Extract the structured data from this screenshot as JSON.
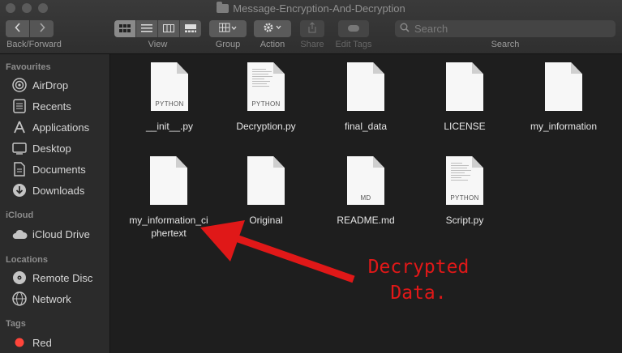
{
  "window": {
    "title": "Message-Encryption-And-Decryption"
  },
  "toolbar": {
    "back_forward_label": "Back/Forward",
    "view_label": "View",
    "group_label": "Group",
    "action_label": "Action",
    "share_label": "Share",
    "edit_tags_label": "Edit Tags",
    "search_label": "Search",
    "search_placeholder": "Search"
  },
  "sidebar": {
    "favourites": {
      "heading": "Favourites",
      "items": [
        {
          "label": "AirDrop",
          "icon": "airdrop-icon"
        },
        {
          "label": "Recents",
          "icon": "recents-icon"
        },
        {
          "label": "Applications",
          "icon": "applications-icon"
        },
        {
          "label": "Desktop",
          "icon": "desktop-icon"
        },
        {
          "label": "Documents",
          "icon": "documents-icon"
        },
        {
          "label": "Downloads",
          "icon": "downloads-icon"
        }
      ]
    },
    "icloud": {
      "heading": "iCloud",
      "items": [
        {
          "label": "iCloud Drive",
          "icon": "cloud-icon"
        }
      ]
    },
    "locations": {
      "heading": "Locations",
      "items": [
        {
          "label": "Remote Disc",
          "icon": "disc-icon"
        },
        {
          "label": "Network",
          "icon": "network-icon"
        }
      ]
    },
    "tags": {
      "heading": "Tags",
      "items": [
        {
          "label": "Red",
          "color": "#ff453a"
        }
      ]
    }
  },
  "files": [
    {
      "name": "__init__.py",
      "ext": "PYTHON",
      "preview": false
    },
    {
      "name": "Decryption.py",
      "ext": "PYTHON",
      "preview": true
    },
    {
      "name": "final_data",
      "ext": "",
      "preview": false
    },
    {
      "name": "LICENSE",
      "ext": "",
      "preview": false
    },
    {
      "name": "my_information",
      "ext": "",
      "preview": false
    },
    {
      "name_line1": "my_information_ci",
      "name_line2": "phertext",
      "ext": "",
      "preview": false
    },
    {
      "name": "Original",
      "ext": "",
      "preview": false
    },
    {
      "name": "README.md",
      "ext": "MD",
      "preview": false
    },
    {
      "name": "Script.py",
      "ext": "PYTHON",
      "preview": true
    }
  ],
  "annotation": {
    "line1": "Decrypted",
    "line2": "Data.",
    "color": "#e01818"
  }
}
